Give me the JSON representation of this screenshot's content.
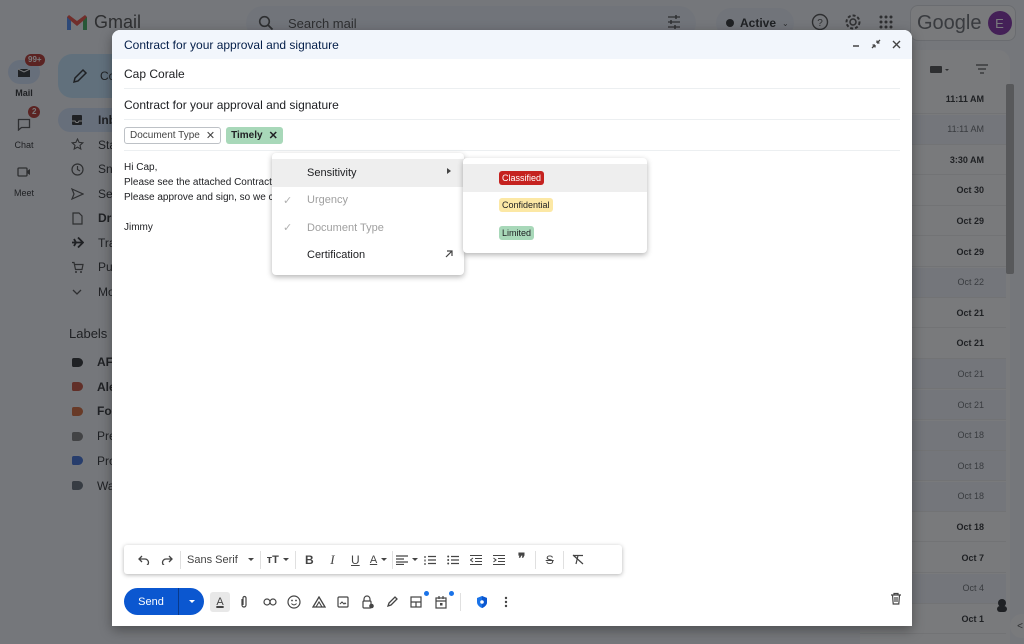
{
  "app": {
    "name": "Gmail",
    "brand_color": "#ea4335"
  },
  "rail": [
    {
      "label": "Mail",
      "badge": "99+",
      "icon": "mail-icon"
    },
    {
      "label": "Chat",
      "badge": "2",
      "icon": "chat-icon"
    },
    {
      "label": "Meet",
      "badge": "",
      "icon": "video-icon"
    }
  ],
  "search": {
    "placeholder": "Search mail"
  },
  "status": {
    "label": "Active"
  },
  "account": {
    "brand": "Google",
    "avatar_initial": "E",
    "avatar_color": "#7b1fa2"
  },
  "nav": {
    "compose_label": "Co",
    "items": [
      {
        "label": "Inb",
        "icon": "inbox-icon"
      },
      {
        "label": "Sta",
        "icon": "star-icon"
      },
      {
        "label": "Sn",
        "icon": "clock-icon"
      },
      {
        "label": "Se",
        "icon": "send-icon"
      },
      {
        "label": "Dr",
        "icon": "draft-icon"
      },
      {
        "label": "Tra",
        "icon": "plane-icon"
      },
      {
        "label": "Pu",
        "icon": "cart-icon"
      },
      {
        "label": "Mo",
        "icon": "chevron-down-icon"
      }
    ],
    "labels_heading": "Labels",
    "labels": [
      {
        "label": "AF",
        "color": "#202124"
      },
      {
        "label": "Ale",
        "color": "#c2452d"
      },
      {
        "label": "Fo",
        "color": "#d5602b"
      },
      {
        "label": "Pre",
        "color": "#777777"
      },
      {
        "label": "Pro",
        "color": "#3367d6"
      },
      {
        "label": "Wa",
        "color": "#5a6470"
      }
    ]
  },
  "mail_list": {
    "rows": [
      {
        "time": "11:11 AM",
        "state": "unread"
      },
      {
        "time": "11:11 AM",
        "state": "read"
      },
      {
        "time": "3:30 AM",
        "state": "unread"
      },
      {
        "time": "Oct 30",
        "state": "unread"
      },
      {
        "time": "Oct 29",
        "state": "unread"
      },
      {
        "time": "Oct 29",
        "state": "unread"
      },
      {
        "time": "Oct 22",
        "state": "read"
      },
      {
        "time": "Oct 21",
        "state": "unread"
      },
      {
        "time": "Oct 21",
        "state": "unread"
      },
      {
        "time": "Oct 21",
        "state": "read"
      },
      {
        "time": "Oct 21",
        "state": "read"
      },
      {
        "time": "Oct 18",
        "state": "read"
      },
      {
        "time": "Oct 18",
        "state": "read"
      },
      {
        "time": "Oct 18",
        "state": "read"
      },
      {
        "time": "Oct 18",
        "state": "unread"
      },
      {
        "time": "Oct 7",
        "state": "unread"
      },
      {
        "time": "Oct 4",
        "state": "read"
      },
      {
        "time": "Oct 1",
        "state": "unread"
      }
    ]
  },
  "compose": {
    "title": "Contract for your approval and signature",
    "to": "Cap Corale",
    "subject": "Contract for your approval and signature",
    "chips": [
      {
        "label": "Document Type",
        "style": "outline"
      },
      {
        "label": "Timely",
        "style": "green"
      }
    ],
    "body_lines": [
      "Hi Cap,",
      "Please see the attached Contract.",
      "Please approve and sign, so we c",
      "",
      "Jimmy"
    ],
    "send_label": "Send",
    "font_name": "Sans Serif"
  },
  "label_menu": {
    "items": [
      {
        "label": "Sensitivity",
        "checked": false,
        "disabled": false,
        "submenu": true
      },
      {
        "label": "Urgency",
        "checked": true,
        "disabled": true,
        "submenu": false
      },
      {
        "label": "Document Type",
        "checked": true,
        "disabled": true,
        "submenu": false
      },
      {
        "label": "Certification",
        "checked": false,
        "disabled": false,
        "external": true
      }
    ],
    "submenu": [
      {
        "label": "Classified",
        "color": "#c5221f"
      },
      {
        "label": "Confidential",
        "color": "#fce8a5"
      },
      {
        "label": "Limited",
        "color": "#a8d8b9"
      }
    ]
  }
}
